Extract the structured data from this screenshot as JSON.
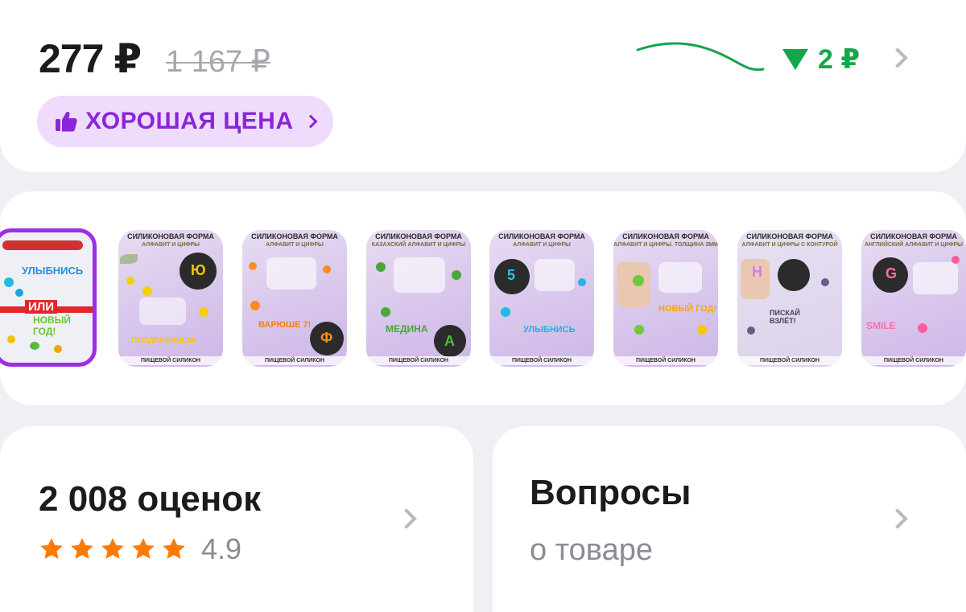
{
  "price": {
    "current": "277 ₽",
    "old": "1 167 ₽",
    "drop": "2 ₽",
    "drop_color": "#11a84a",
    "badge_label": "ХОРОШАЯ ЦЕНА",
    "badge_icon": "thumbs-up-icon",
    "badge_color": "#8b25d9"
  },
  "gallery": {
    "thumbnails": [
      {
        "title": "",
        "subtitle": "",
        "footer": "",
        "words": [
          "УЛЫБНИСЬ",
          "ИЛИ",
          "НОВЫЙ ГОД!"
        ],
        "active": true
      },
      {
        "title": "СИЛИКОНОВАЯ ФОРМА",
        "subtitle": "АЛФАВИТ И ЦИФРЫ",
        "footer": "ПИЩЕВОЙ СИЛИКОН",
        "words": [
          "Ю",
          "ПОЗДРАВЛЯЕМ!"
        ],
        "active": false
      },
      {
        "title": "СИЛИКОНОВАЯ ФОРМА",
        "subtitle": "АЛФАВИТ И ЦИФРЫ",
        "footer": "ПИЩЕВОЙ СИЛИКОН",
        "words": [
          "ВАРЮШЕ 7!",
          "Ф"
        ],
        "active": false
      },
      {
        "title": "СИЛИКОНОВАЯ ФОРМА",
        "subtitle": "КАЗАХСКИЙ АЛФАВИТ И ЦИФРЫ",
        "footer": "ПИЩЕВОЙ СИЛИКОН",
        "words": [
          "МЕДИНА",
          "А"
        ],
        "active": false
      },
      {
        "title": "СИЛИКОНОВАЯ ФОРМА",
        "subtitle": "АЛФАВИТ И ЦИФРЫ",
        "footer": "ПИЩЕВОЙ СИЛИКОН",
        "words": [
          "5",
          "УЛЫБНИСЬ"
        ],
        "active": false
      },
      {
        "title": "СИЛИКОНОВАЯ ФОРМА",
        "subtitle": "АЛФАВИТ И ЦИФРЫ. ТОЛЩИНА 3ММ",
        "footer": "ПИЩЕВОЙ СИЛИКОН",
        "words": [
          "НОВЫЙ ГОД!"
        ],
        "active": false
      },
      {
        "title": "СИЛИКОНОВАЯ ФОРМА",
        "subtitle": "АЛФАВИТ И ЦИФРЫ С КОНТУРОЙ",
        "footer": "ПИЩЕВОЙ СИЛИКОН",
        "words": [
          "Н",
          "ПИСКАЙ ВЗЛЁТ!"
        ],
        "active": false
      },
      {
        "title": "СИЛИКОНОВАЯ ФОРМА",
        "subtitle": "АНГЛИЙСКИЙ АЛФАВИТ И ЦИФРЫ",
        "footer": "ПИЩЕВОЙ СИЛИКОН",
        "words": [
          "G",
          "SMILE"
        ],
        "active": false
      }
    ]
  },
  "ratings": {
    "title": "2 008 оценок",
    "value": "4.9",
    "stars": 5,
    "star_color": "#ff7a00"
  },
  "questions": {
    "title": "Вопросы",
    "subtitle": "о товаре"
  }
}
